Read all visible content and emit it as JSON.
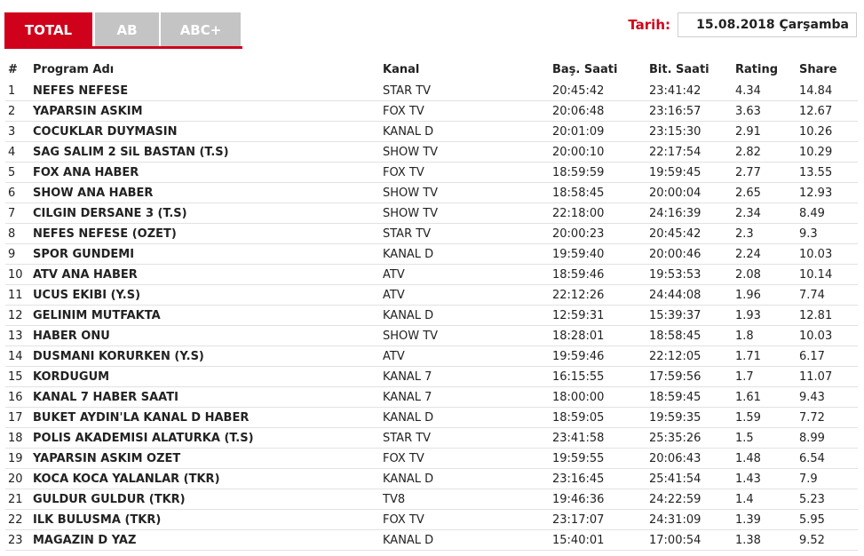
{
  "tabs": [
    {
      "label": "TOTAL",
      "active": true
    },
    {
      "label": "AB",
      "active": false
    },
    {
      "label": "ABC+",
      "active": false
    }
  ],
  "date": {
    "label": "Tarih:",
    "value": "15.08.2018 Çarşamba"
  },
  "colors": {
    "accent": "#d0021b",
    "tab_inactive": "#c4c4c4",
    "row_border": "#e2e2e2"
  },
  "table": {
    "headers": [
      "#",
      "Program Adı",
      "Kanal",
      "Baş. Saati",
      "Bit. Saati",
      "Rating",
      "Share"
    ],
    "rows": [
      [
        "1",
        "NEFES NEFESE",
        "STAR TV",
        "20:45:42",
        "23:41:42",
        "4.34",
        "14.84"
      ],
      [
        "2",
        "YAPARSIN ASKIM",
        "FOX TV",
        "20:06:48",
        "23:16:57",
        "3.63",
        "12.67"
      ],
      [
        "3",
        "COCUKLAR DUYMASIN",
        "KANAL D",
        "20:01:09",
        "23:15:30",
        "2.91",
        "10.26"
      ],
      [
        "4",
        "SAG SALIM 2 SiL BASTAN (T.S)",
        "SHOW TV",
        "20:00:10",
        "22:17:54",
        "2.82",
        "10.29"
      ],
      [
        "5",
        "FOX ANA HABER",
        "FOX TV",
        "18:59:59",
        "19:59:45",
        "2.77",
        "13.55"
      ],
      [
        "6",
        "SHOW ANA HABER",
        "SHOW TV",
        "18:58:45",
        "20:00:04",
        "2.65",
        "12.93"
      ],
      [
        "7",
        "CILGIN DERSANE 3 (T.S)",
        "SHOW TV",
        "22:18:00",
        "24:16:39",
        "2.34",
        "8.49"
      ],
      [
        "8",
        "NEFES NEFESE (OZET)",
        "STAR TV",
        "20:00:23",
        "20:45:42",
        "2.3",
        "9.3"
      ],
      [
        "9",
        "SPOR GUNDEMI",
        "KANAL D",
        "19:59:40",
        "20:00:46",
        "2.24",
        "10.03"
      ],
      [
        "10",
        "ATV ANA HABER",
        "ATV",
        "18:59:46",
        "19:53:53",
        "2.08",
        "10.14"
      ],
      [
        "11",
        "UCUS EKIBI (Y.S)",
        "ATV",
        "22:12:26",
        "24:44:08",
        "1.96",
        "7.74"
      ],
      [
        "12",
        "GELINIM MUTFAKTA",
        "KANAL D",
        "12:59:31",
        "15:39:37",
        "1.93",
        "12.81"
      ],
      [
        "13",
        "HABER ONU",
        "SHOW TV",
        "18:28:01",
        "18:58:45",
        "1.8",
        "10.03"
      ],
      [
        "14",
        "DUSMANI KORURKEN (Y.S)",
        "ATV",
        "19:59:46",
        "22:12:05",
        "1.71",
        "6.17"
      ],
      [
        "15",
        "KORDUGUM",
        "KANAL 7",
        "16:15:55",
        "17:59:56",
        "1.7",
        "11.07"
      ],
      [
        "16",
        "KANAL 7 HABER SAATI",
        "KANAL 7",
        "18:00:00",
        "18:59:45",
        "1.61",
        "9.43"
      ],
      [
        "17",
        "BUKET AYDIN'LA KANAL D HABER",
        "KANAL D",
        "18:59:05",
        "19:59:35",
        "1.59",
        "7.72"
      ],
      [
        "18",
        "POLIS AKADEMISI ALATURKA (T.S)",
        "STAR TV",
        "23:41:58",
        "25:35:26",
        "1.5",
        "8.99"
      ],
      [
        "19",
        "YAPARSIN ASKIM OZET",
        "FOX TV",
        "19:59:55",
        "20:06:43",
        "1.48",
        "6.54"
      ],
      [
        "20",
        "KOCA KOCA YALANLAR (TKR)",
        "KANAL D",
        "23:16:45",
        "25:41:54",
        "1.43",
        "7.9"
      ],
      [
        "21",
        "GULDUR GULDUR (TKR)",
        "TV8",
        "19:46:36",
        "24:22:59",
        "1.4",
        "5.23"
      ],
      [
        "22",
        "ILK BULUSMA (TKR)",
        "FOX TV",
        "23:17:07",
        "24:31:09",
        "1.39",
        "5.95"
      ],
      [
        "23",
        "MAGAZIN D YAZ",
        "KANAL D",
        "15:40:01",
        "17:00:54",
        "1.38",
        "9.52"
      ]
    ]
  }
}
